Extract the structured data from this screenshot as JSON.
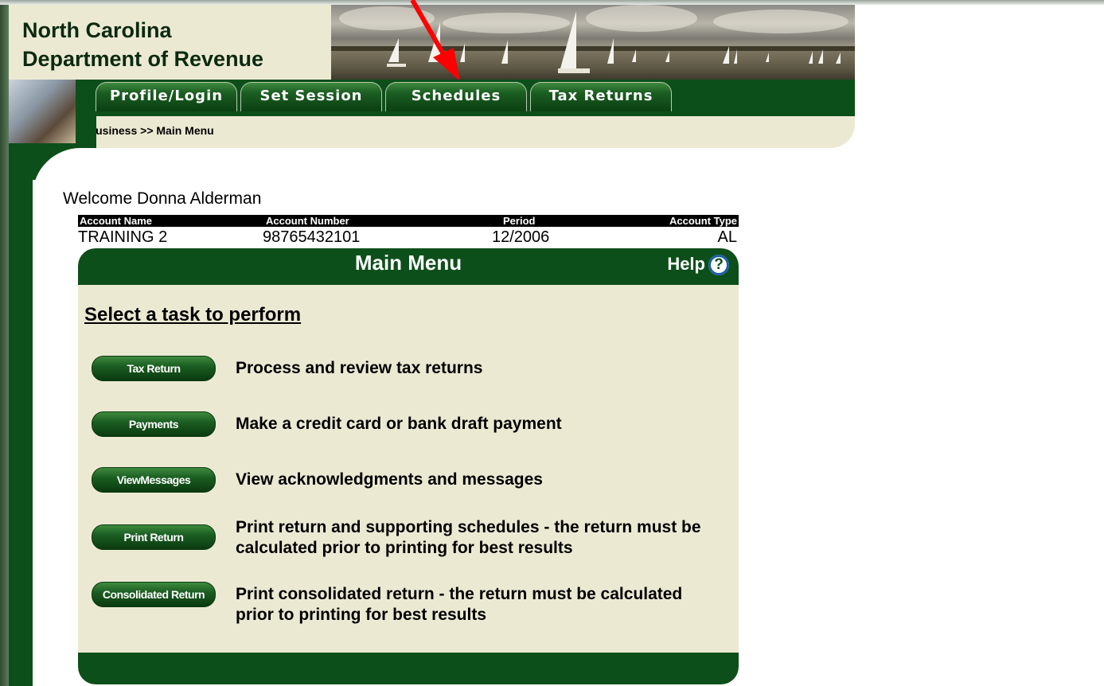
{
  "header": {
    "title_line1": "North Carolina",
    "title_line2": "Department of Revenue"
  },
  "nav": {
    "tabs": [
      "Profile/Login",
      "Set Session",
      "Schedules",
      "Tax Returns"
    ]
  },
  "breadcrumb": "Business >> Main Menu",
  "welcome": "Welcome Donna Alderman",
  "account": {
    "headers": [
      "Account Name",
      "Account Number",
      "Period",
      "Account Type"
    ],
    "values": [
      "TRAINING 2",
      "98765432101",
      "12/2006",
      "AL"
    ]
  },
  "panel": {
    "title": "Main Menu",
    "help_label": "Help",
    "help_icon": "?",
    "select_label": "Select a task to perform"
  },
  "tasks": [
    {
      "button": "Tax Return",
      "desc_line1": "Process and review tax returns",
      "desc_line2": ""
    },
    {
      "button": "Payments",
      "desc_line1": "Make a credit card or bank draft payment",
      "desc_line2": ""
    },
    {
      "button": "ViewMessages",
      "desc_line1": "View acknowledgments and messages",
      "desc_line2": ""
    },
    {
      "button": "Print Return",
      "desc_line1": "Print return and supporting schedules - the return must be",
      "desc_line2": "calculated prior to printing for best results"
    },
    {
      "button": "Consolidated Return",
      "desc_line1": "Print consolidated return - the return must be calculated",
      "desc_line2": "prior to printing for best results"
    }
  ],
  "colors": {
    "brand_green": "#0d4f1a",
    "panel_beige": "#ece9d3",
    "annotation_arrow": "#ff0000"
  }
}
